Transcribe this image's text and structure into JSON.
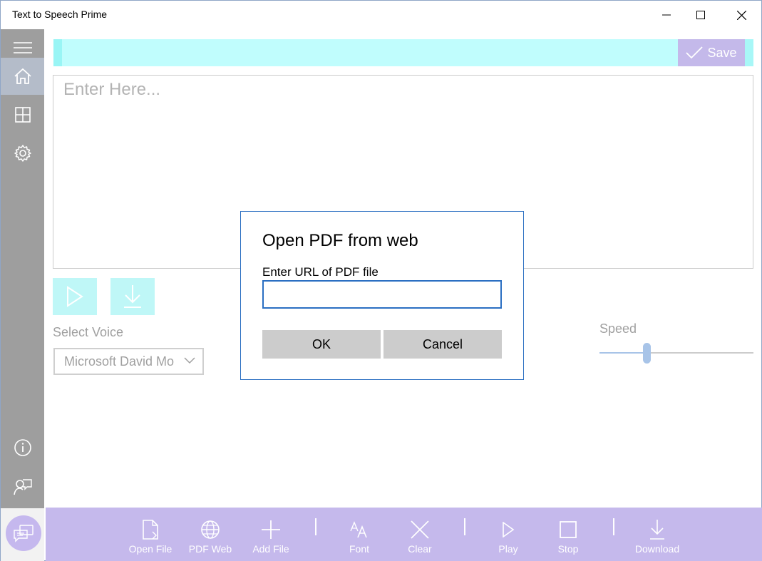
{
  "window": {
    "title": "Text to Speech Prime",
    "controls": [
      "minimize-icon",
      "maximize-icon",
      "close-icon"
    ]
  },
  "sidebar": {
    "items": [
      {
        "icon": "hamburger-menu-icon"
      },
      {
        "icon": "home-icon",
        "active": true
      },
      {
        "icon": "grid-icon"
      },
      {
        "icon": "gear-icon"
      }
    ],
    "bottom_items": [
      {
        "icon": "info-icon"
      },
      {
        "icon": "feedback-icon"
      },
      {
        "icon": "chat-icon"
      }
    ]
  },
  "topbar": {
    "save_label": "Save"
  },
  "editor": {
    "placeholder": "Enter Here..."
  },
  "controls": {
    "select_voice_label": "Select Voice",
    "voice_selected": "Microsoft David Mo",
    "speed_label": "Speed",
    "speed_value": 0.31
  },
  "dialog": {
    "title": "Open PDF from web",
    "url_label": "Enter URL of PDF file",
    "url_value": "",
    "ok_label": "OK",
    "cancel_label": "Cancel"
  },
  "toolbar": {
    "items": [
      {
        "label": "Open File",
        "icon": "open-file-icon"
      },
      {
        "label": "PDF Web",
        "icon": "globe-icon"
      },
      {
        "label": "Add File",
        "icon": "plus-icon"
      },
      {
        "label": "Font",
        "icon": "font-size-icon"
      },
      {
        "label": "Clear",
        "icon": "clear-x-icon"
      },
      {
        "label": "Play",
        "icon": "play-icon"
      },
      {
        "label": "Stop",
        "icon": "stop-icon"
      },
      {
        "label": "Download",
        "icon": "download-icon"
      }
    ]
  },
  "colors": {
    "cyan_bar": "#c0fdfd",
    "purple_accent": "#c5b9ec",
    "sidebar_gray": "#9e9e9e",
    "dialog_border": "#2b6fc2"
  }
}
